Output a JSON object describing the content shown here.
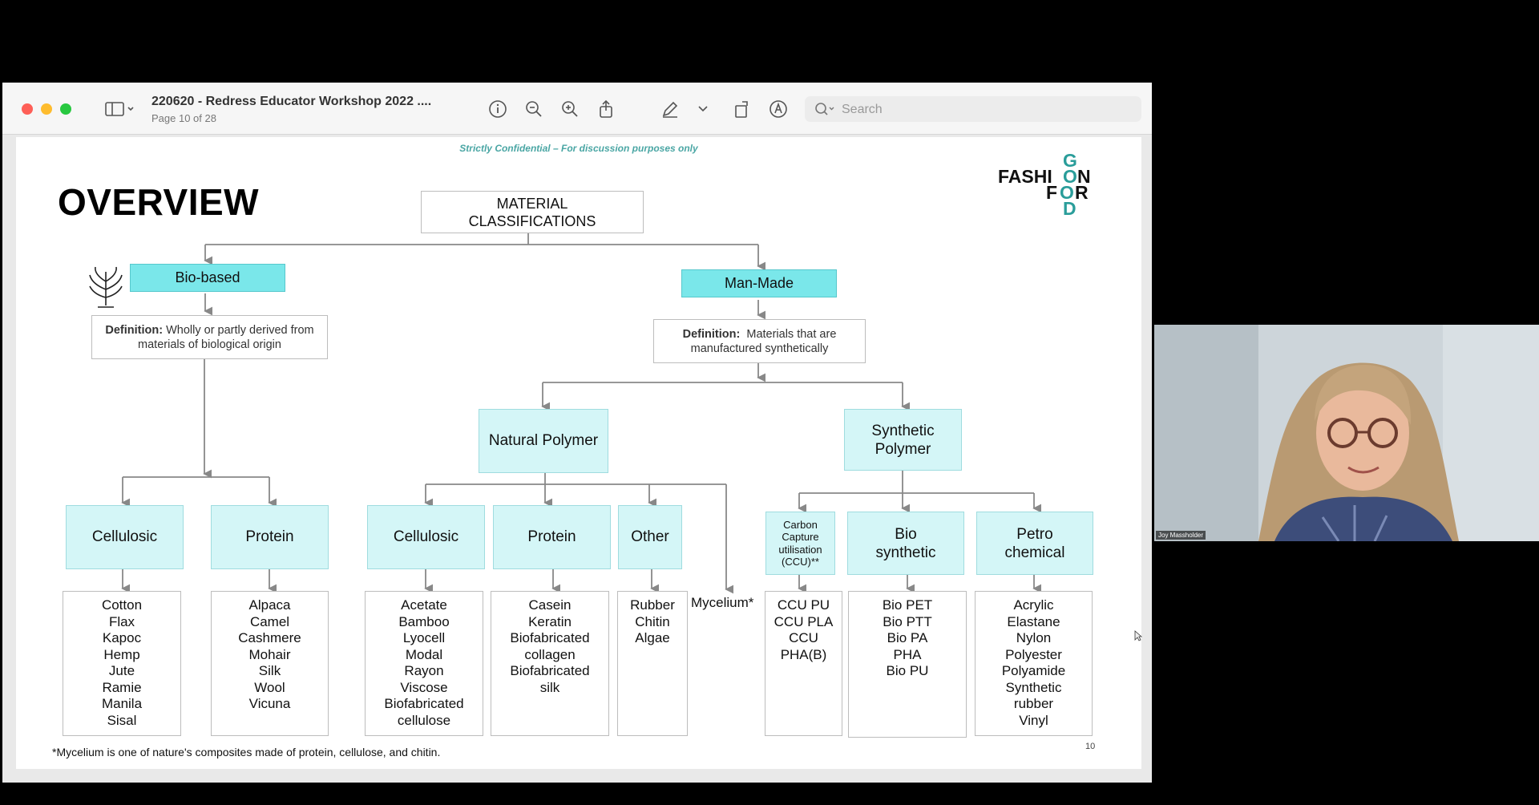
{
  "window": {
    "title": "220620 - Redress Educator Workshop 2022 ....",
    "page_indicator": "Page 10 of 28",
    "search_placeholder": "Search"
  },
  "slide": {
    "confidential": "Strictly Confidential – For discussion purposes only",
    "heading": "OVERVIEW",
    "logo_text": "FASHION FOR GOOD",
    "root": "MATERIAL CLASSIFICATIONS",
    "bio": {
      "label": "Bio-based",
      "definition_label": "Definition:",
      "definition_text": "Wholly or partly derived from materials of biological origin",
      "cellulosic": {
        "label": "Cellulosic",
        "items": [
          "Cotton",
          "Flax",
          "Kapoc",
          "Hemp",
          "Jute",
          "Ramie",
          "Manila",
          "Sisal"
        ]
      },
      "protein": {
        "label": "Protein",
        "items": [
          "Alpaca",
          "Camel",
          "Cashmere",
          "Mohair",
          "Silk",
          "Wool",
          "Vicuna"
        ]
      }
    },
    "manmade": {
      "label": "Man-Made",
      "definition_label": "Definition:",
      "definition_text": "Materials that are manufactured synthetically",
      "natural_polymer": {
        "label": "Natural Polymer",
        "cellulosic": {
          "label": "Cellulosic",
          "items": [
            "Acetate",
            "Bamboo",
            "Lyocell",
            "Modal",
            "Rayon",
            "Viscose",
            "Biofabricated",
            "cellulose"
          ]
        },
        "protein": {
          "label": "Protein",
          "items": [
            "Casein",
            "Keratin",
            "Biofabricated",
            "collagen",
            "Biofabricated",
            "silk"
          ]
        },
        "other": {
          "label": "Other",
          "items": [
            "Rubber",
            "Chitin",
            "Algae"
          ]
        },
        "mycelium": "Mycelium*"
      },
      "synthetic_polymer": {
        "label": "Synthetic Polymer",
        "ccu": {
          "label": "Carbon Capture utilisation (CCU)**",
          "items": [
            "CCU PU",
            "CCU PLA",
            "CCU",
            "PHA(B)"
          ]
        },
        "bio_synthetic": {
          "label": "Bio synthetic",
          "items": [
            "Bio PET",
            "Bio PTT",
            "Bio PA",
            "PHA",
            "Bio PU"
          ]
        },
        "petro_chemical": {
          "label": "Petro chemical",
          "items": [
            "Acrylic",
            "Elastane",
            "Nylon",
            "Polyester",
            "Polyamide",
            "Synthetic",
            "rubber",
            "Vinyl"
          ]
        }
      }
    },
    "footnote": "*Mycelium is one of nature's composites made of protein, cellulose, and chitin.",
    "page_number": "10"
  },
  "video": {
    "participant_name": "Joy Massholder"
  },
  "colors": {
    "cyan": "#7ae7ea",
    "light_cyan": "#d4f6f7",
    "teal_logo": "#2a9d9a"
  }
}
